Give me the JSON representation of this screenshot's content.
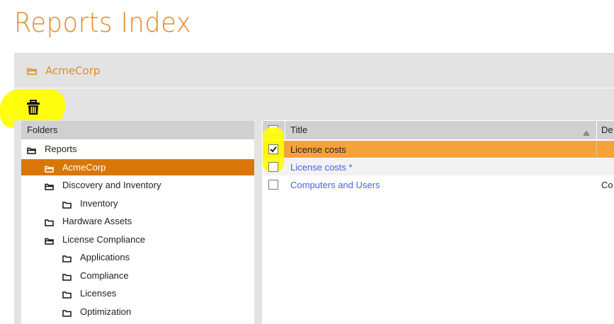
{
  "page": {
    "title": "Reports Index"
  },
  "breadcrumb": {
    "current": "AcmeCorp"
  },
  "toolbar": {
    "delete_icon": "trash-icon"
  },
  "folders": {
    "header": "Folders",
    "items": [
      {
        "label": "Reports",
        "icon": "folder-open-icon",
        "level": 0
      },
      {
        "label": "AcmeCorp",
        "icon": "folder-open-icon",
        "level": 1,
        "selected": true
      },
      {
        "label": "Discovery and Inventory",
        "icon": "folder-open-icon",
        "level": 1
      },
      {
        "label": "Inventory",
        "icon": "folder-icon",
        "level": 2
      },
      {
        "label": "Hardware Assets",
        "icon": "folder-icon",
        "level": 1
      },
      {
        "label": "License Compliance",
        "icon": "folder-open-icon",
        "level": 1
      },
      {
        "label": "Applications",
        "icon": "folder-icon",
        "level": 2
      },
      {
        "label": "Compliance",
        "icon": "folder-icon",
        "level": 2
      },
      {
        "label": "Licenses",
        "icon": "folder-icon",
        "level": 2
      },
      {
        "label": "Optimization",
        "icon": "folder-icon",
        "level": 2
      }
    ]
  },
  "reports": {
    "columns": {
      "title": "Title",
      "description": "De"
    },
    "rows": [
      {
        "title": "License costs",
        "description": "",
        "checked": true,
        "selected": true
      },
      {
        "title": "License costs *",
        "description": "",
        "checked": false
      },
      {
        "title": "Computers and Users",
        "description": "Co",
        "checked": false
      }
    ]
  },
  "colors": {
    "accent": "#e08a2a",
    "selected_folder": "#d97706",
    "selected_row": "#f6a23a",
    "link": "#4a5ee8",
    "highlight": "#ffff00"
  }
}
